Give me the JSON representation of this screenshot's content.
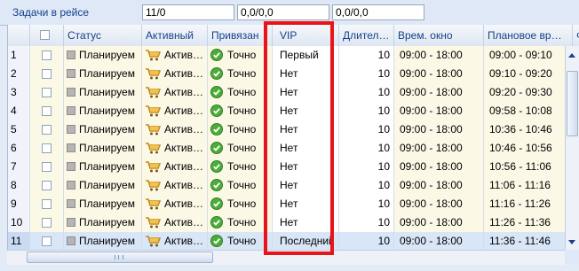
{
  "topbar": {
    "title": "Задачи в рейсе",
    "field1": "11/0",
    "field2": "0,0/0,0",
    "field3": "0,0/0,0"
  },
  "columns": {
    "status": "Статус",
    "active": "Активный",
    "bound": "Привязан",
    "vip": "VIP",
    "duration": "Длител…",
    "window": "Врем. окно",
    "planned": "Плановое вр…",
    "extra": "Ф"
  },
  "rows": [
    {
      "num": "1",
      "status": "Планируем",
      "active": "Актив…",
      "bound": "Точно",
      "vip": "Первый",
      "duration": "10",
      "window": "09:00 - 18:00",
      "planned": "09:00 - 09:10"
    },
    {
      "num": "2",
      "status": "Планируем",
      "active": "Актив…",
      "bound": "Точно",
      "vip": "Нет",
      "duration": "10",
      "window": "09:00 - 18:00",
      "planned": "09:10 - 09:20"
    },
    {
      "num": "3",
      "status": "Планируем",
      "active": "Актив…",
      "bound": "Точно",
      "vip": "Нет",
      "duration": "10",
      "window": "09:00 - 18:00",
      "planned": "09:20 - 09:30"
    },
    {
      "num": "4",
      "status": "Планируем",
      "active": "Актив…",
      "bound": "Точно",
      "vip": "Нет",
      "duration": "10",
      "window": "09:00 - 18:00",
      "planned": "09:58 - 10:08"
    },
    {
      "num": "5",
      "status": "Планируем",
      "active": "Актив…",
      "bound": "Точно",
      "vip": "Нет",
      "duration": "10",
      "window": "09:00 - 18:00",
      "planned": "10:36 - 10:46"
    },
    {
      "num": "6",
      "status": "Планируем",
      "active": "Актив…",
      "bound": "Точно",
      "vip": "Нет",
      "duration": "10",
      "window": "09:00 - 18:00",
      "planned": "10:46 - 10:56"
    },
    {
      "num": "7",
      "status": "Планируем",
      "active": "Актив…",
      "bound": "Точно",
      "vip": "Нет",
      "duration": "10",
      "window": "09:00 - 18:00",
      "planned": "10:56 - 11:06"
    },
    {
      "num": "8",
      "status": "Планируем",
      "active": "Актив…",
      "bound": "Точно",
      "vip": "Нет",
      "duration": "10",
      "window": "09:00 - 18:00",
      "planned": "11:06 - 11:16"
    },
    {
      "num": "9",
      "status": "Планируем",
      "active": "Актив…",
      "bound": "Точно",
      "vip": "Нет",
      "duration": "10",
      "window": "09:00 - 18:00",
      "planned": "11:16 - 11:26"
    },
    {
      "num": "10",
      "status": "Планируем",
      "active": "Актив…",
      "bound": "Точно",
      "vip": "Нет",
      "duration": "10",
      "window": "09:00 - 18:00",
      "planned": "11:26 - 11:36"
    },
    {
      "num": "11",
      "status": "Планируем",
      "active": "Актив…",
      "bound": "Точно",
      "vip": "Последний",
      "duration": "10",
      "window": "09:00 - 18:00",
      "planned": "11:36 - 11:46"
    }
  ],
  "icons": {
    "status": "gray-square-icon",
    "active": "shopping-cart-icon",
    "bound": "green-check-circle-icon"
  },
  "colors": {
    "highlight": "#e8141a",
    "header_text": "#15428b",
    "row_highlight": "#fbf9e6"
  }
}
